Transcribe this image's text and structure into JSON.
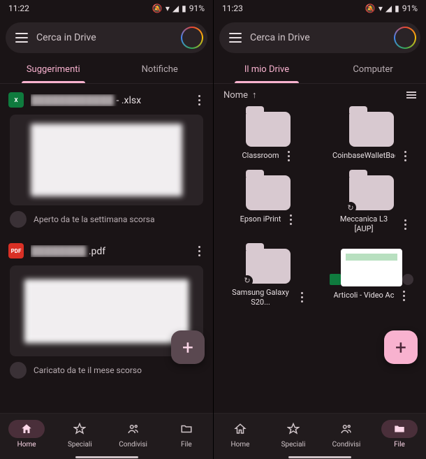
{
  "left": {
    "status": {
      "time": "11:22",
      "battery": "91%"
    },
    "search": {
      "placeholder": "Cerca in Drive"
    },
    "tabs": {
      "suggestions": "Suggerimenti",
      "notifications": "Notifiche",
      "activeIndex": 0
    },
    "cards": [
      {
        "icon": "xlsx",
        "nameBlur": "████████████",
        "nameExt": "- .xlsx",
        "subtitle": "Aperto da te la settimana scorsa"
      },
      {
        "icon": "pdf",
        "nameBlur": "████████",
        "nameExt": ".pdf",
        "subtitle": "Caricato da te il mese scorso"
      }
    ],
    "nav": {
      "home": "Home",
      "starred": "Speciali",
      "shared": "Condivisi",
      "files": "File",
      "activeIndex": 0
    }
  },
  "right": {
    "status": {
      "time": "11:23",
      "battery": "91%"
    },
    "search": {
      "placeholder": "Cerca in Drive"
    },
    "tabs": {
      "mydrive": "Il mio Drive",
      "computer": "Computer",
      "activeIndex": 0
    },
    "sort": {
      "label": "Nome",
      "direction": "↑"
    },
    "folders": [
      {
        "label": "Classroom",
        "sync": false
      },
      {
        "label": "CoinbaseWalletBackups",
        "sync": false
      },
      {
        "label": "Epson iPrint",
        "sync": false
      },
      {
        "label": "Meccanica L3 [AUP]",
        "sync": true
      },
      {
        "label": "Samsung Galaxy S20...",
        "sync": true
      },
      {
        "label": "Articoli - Video Ac",
        "type": "file",
        "app": "sheets"
      }
    ],
    "nav": {
      "home": "Home",
      "starred": "Speciali",
      "shared": "Condivisi",
      "files": "File",
      "activeIndex": 3
    }
  },
  "icons": {
    "dnd": "🔕",
    "wifi": "▾",
    "signal": "◢",
    "batt": "▮"
  }
}
